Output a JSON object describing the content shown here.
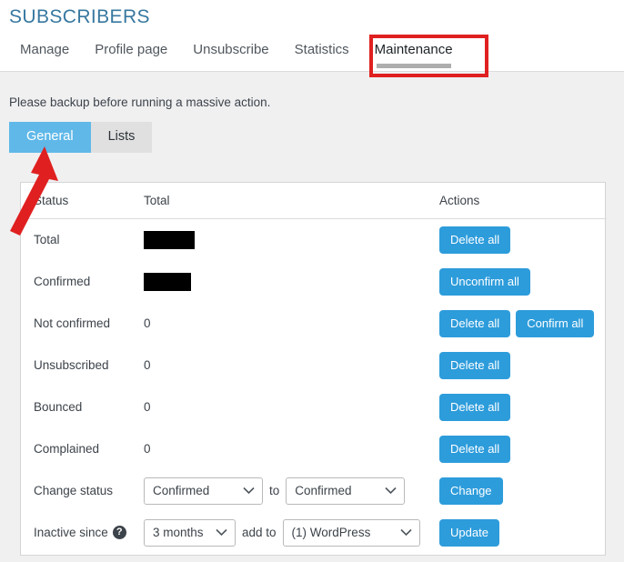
{
  "header": {
    "title": "SUBSCRIBERS",
    "tabs": [
      {
        "label": "Manage",
        "active": false
      },
      {
        "label": "Profile page",
        "active": false
      },
      {
        "label": "Unsubscribe",
        "active": false
      },
      {
        "label": "Statistics",
        "active": false
      },
      {
        "label": "Maintenance",
        "active": true
      }
    ]
  },
  "notice": "Please backup before running a massive action.",
  "sub_tabs": [
    {
      "label": "General",
      "active": true
    },
    {
      "label": "Lists",
      "active": false
    }
  ],
  "table": {
    "columns": {
      "status": "Status",
      "total": "Total",
      "actions": "Actions"
    },
    "rows": [
      {
        "status": "Total",
        "total": "REDACTED",
        "redacted": true,
        "actions": [
          "Delete all"
        ]
      },
      {
        "status": "Confirmed",
        "total": "REDACTED",
        "redacted": true,
        "actions": [
          "Unconfirm all"
        ]
      },
      {
        "status": "Not confirmed",
        "total": "0",
        "redacted": false,
        "actions": [
          "Delete all",
          "Confirm all"
        ]
      },
      {
        "status": "Unsubscribed",
        "total": "0",
        "redacted": false,
        "actions": [
          "Delete all"
        ]
      },
      {
        "status": "Bounced",
        "total": "0",
        "redacted": false,
        "actions": [
          "Delete all"
        ]
      },
      {
        "status": "Complained",
        "total": "0",
        "redacted": false,
        "actions": [
          "Delete all"
        ]
      }
    ]
  },
  "change_status_row": {
    "label": "Change status",
    "from_value": "Confirmed",
    "connector": "to",
    "to_value": "Confirmed",
    "button": "Change"
  },
  "inactive_row": {
    "label": "Inactive since",
    "help_glyph": "?",
    "period_value": "3 months",
    "connector": "add to",
    "list_value": "(1) WordPress",
    "button": "Update"
  },
  "colors": {
    "title": "#3778a0",
    "button_blue": "#2d9cdb",
    "active_subtab_blue": "#5fb8e8",
    "annotation_red": "#e02020",
    "page_bg": "#f0f0f1"
  },
  "annotations": {
    "rect_target": "Maintenance",
    "arrow_target": "General"
  }
}
